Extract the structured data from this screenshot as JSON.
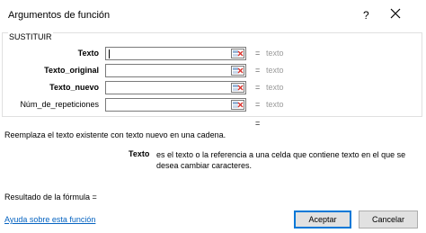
{
  "window": {
    "title": "Argumentos de función",
    "help_glyph": "?"
  },
  "group": {
    "legend": "SUSTITUIR",
    "args": [
      {
        "label": "Texto",
        "value": "",
        "result": "texto"
      },
      {
        "label": "Texto_original",
        "value": "",
        "result": "texto"
      },
      {
        "label": "Texto_nuevo",
        "value": "",
        "result": "texto"
      },
      {
        "label": "Núm_de_repeticiones",
        "value": "",
        "result": "texto"
      }
    ],
    "equals": "="
  },
  "result_equals": "=",
  "description": "Reemplaza el texto existente con texto nuevo en una cadena.",
  "arg_help": {
    "name": "Texto",
    "text": "es el texto o la referencia a una celda que contiene texto en el que se desea cambiar caracteres."
  },
  "formula_result_label": "Resultado de la fórmula =",
  "help_link": "Ayuda sobre esta función",
  "buttons": {
    "ok": "Aceptar",
    "cancel": "Cancelar"
  },
  "colors": {
    "link": "#0563c1",
    "primary_border": "#0078d7",
    "ref_icon_red": "#d9312b"
  },
  "icons": [
    "close-icon",
    "range-select-icon"
  ]
}
